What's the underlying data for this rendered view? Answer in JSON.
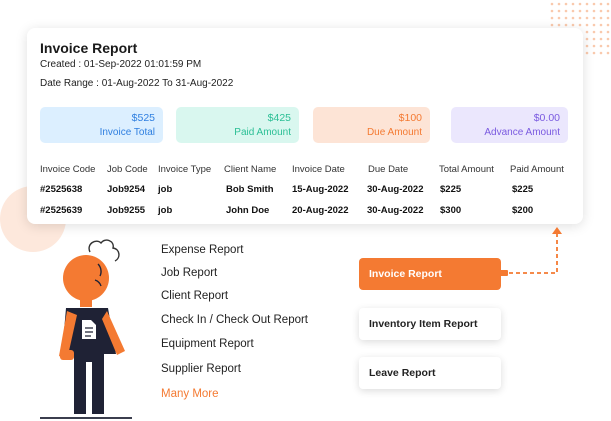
{
  "report": {
    "title": "Invoice Report",
    "created": "Created : 01-Sep-2022 01:01:59 PM",
    "date_range": "Date Range : 01-Aug-2022 To 31-Aug-2022"
  },
  "stats": [
    {
      "value": "$525",
      "label": "Invoice Total",
      "bg": "#dcefff",
      "color": "#2f7fe0"
    },
    {
      "value": "$425",
      "label": "Paid Amount",
      "bg": "#d9f7ef",
      "color": "#2bbf95"
    },
    {
      "value": "$100",
      "label": "Due Amount",
      "bg": "#fde4d6",
      "color": "#f47a32"
    },
    {
      "value": "$0.00",
      "label": "Advance Amount",
      "bg": "#ebe7fd",
      "color": "#7a5ae0"
    }
  ],
  "table": {
    "headers": [
      "Invoice Code",
      "Job Code",
      "Invoice Type",
      "Client Name",
      "Invoice Date",
      "Due Date",
      "Total Amount",
      "Paid Amount"
    ],
    "rows": [
      [
        "#2525638",
        "Job9254",
        "job",
        "Bob Smith",
        "15-Aug-2022",
        "30-Aug-2022",
        "$225",
        "$225"
      ],
      [
        "#2525639",
        "Job9255",
        "job",
        "John Doe",
        "20-Aug-2022",
        "30-Aug-2022",
        "$300",
        "$200"
      ]
    ]
  },
  "report_list": {
    "items": [
      "Expense Report",
      "Job Report",
      "Client Report",
      "Check In / Check Out Report",
      "Equipment Report",
      "Supplier Report"
    ],
    "more": "Many More"
  },
  "report_buttons": [
    "Invoice Report",
    "Inventory Item Report",
    "Leave Report"
  ],
  "colors": {
    "accent": "#f47a32",
    "figure_dark": "#1f2235"
  },
  "icons": [
    "document-icon",
    "person-illustration"
  ]
}
